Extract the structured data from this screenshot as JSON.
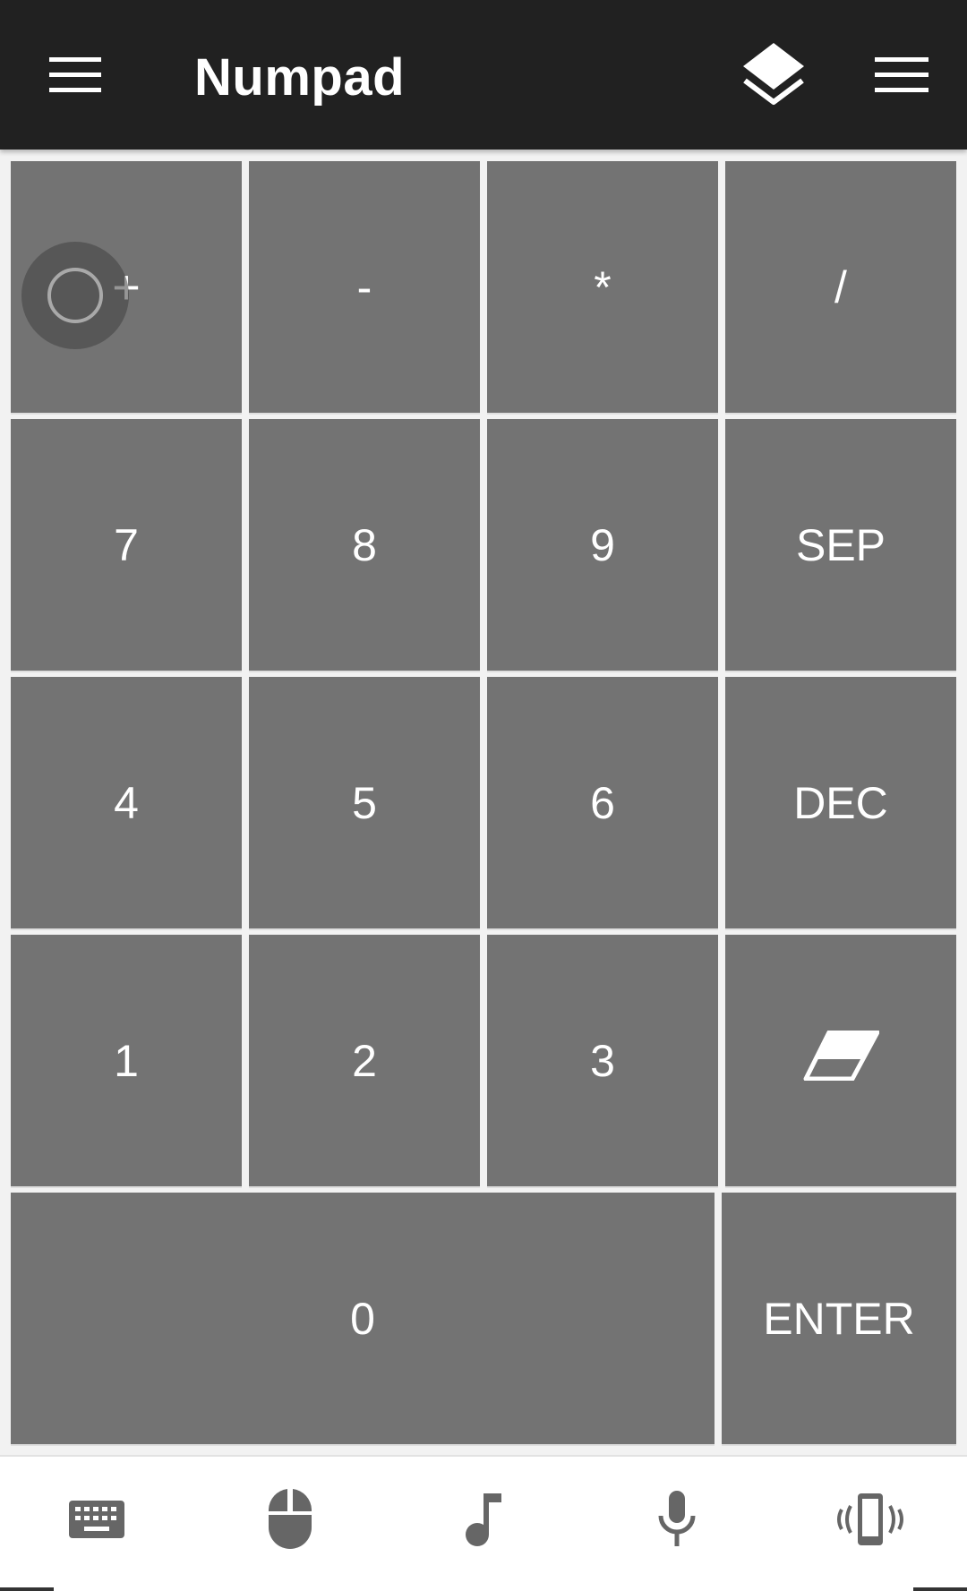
{
  "appbar": {
    "title": "Numpad",
    "left_icon": "menu-icon",
    "layers_icon": "layers-icon",
    "right_icon": "menu-icon",
    "background": "#212121"
  },
  "keypad": {
    "key_color": "#737373",
    "rows": [
      [
        "+",
        "-",
        "*",
        "/"
      ],
      [
        "7",
        "8",
        "9",
        "SEP"
      ],
      [
        "4",
        "5",
        "6",
        "DEC"
      ],
      [
        "1",
        "2",
        "3",
        ""
      ],
      [
        "0",
        "ENTER"
      ]
    ],
    "eraser_icon": "eraser-icon"
  },
  "bottom_nav": {
    "items": [
      {
        "icon": "keyboard-icon"
      },
      {
        "icon": "mouse-icon"
      },
      {
        "icon": "music-note-icon"
      },
      {
        "icon": "microphone-icon"
      },
      {
        "icon": "phone-vibrate-icon"
      }
    ],
    "icon_color": "#666666"
  }
}
